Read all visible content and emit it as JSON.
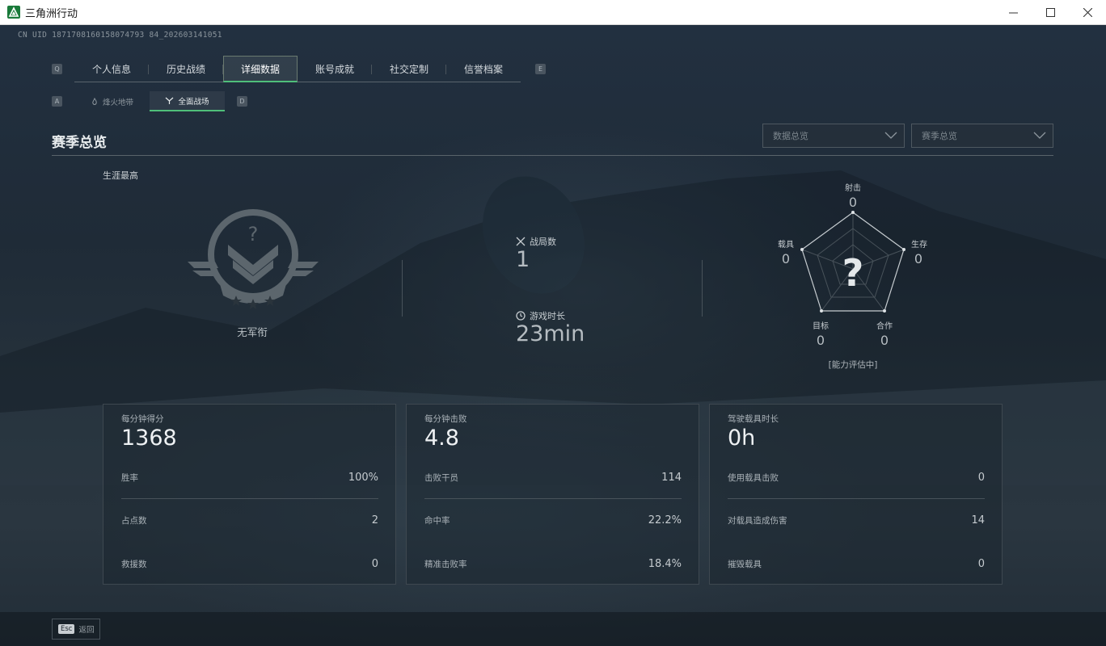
{
  "window": {
    "title": "三角洲行动",
    "minimize": "—",
    "maximize": "☐",
    "close": "✕"
  },
  "uid": "CN UID 18717081601580747938420260314105 1",
  "uid_text": "CN UID 1871708160158074793842026031410 51",
  "uid_display": "CN UID 1871708160158074793842026031410 51",
  "uid_exact": "CN UID 1871708160158074793 84_202603141051",
  "key_hints": {
    "prev_tab": "Q",
    "next_tab": "E",
    "prev_sub": "A",
    "next_sub": "D"
  },
  "main_tabs": [
    {
      "label": "个人信息",
      "active": false
    },
    {
      "label": "历史战绩",
      "active": false
    },
    {
      "label": "详细数据",
      "active": true
    },
    {
      "label": "账号成就",
      "active": false
    },
    {
      "label": "社交定制",
      "active": false
    },
    {
      "label": "信誉档案",
      "active": false
    }
  ],
  "sub_tabs": [
    {
      "label": "烽火地带",
      "icon": "fire-icon",
      "active": false
    },
    {
      "label": "全面战场",
      "icon": "battlefield-icon",
      "active": true
    }
  ],
  "section": {
    "title": "赛季总览"
  },
  "dropdowns": {
    "data": "数据总览",
    "season": "赛季总览"
  },
  "career": {
    "label": "生涯最高",
    "rank_name": "无军衔"
  },
  "summary": {
    "matches_label": "战局数",
    "matches_value": "1",
    "time_label": "游戏时长",
    "time_value": "23min"
  },
  "radar": {
    "shoot_label": "射击",
    "shoot_value": "0",
    "survive_label": "生存",
    "survive_value": "0",
    "coop_label": "合作",
    "coop_value": "0",
    "target_label": "目标",
    "target_value": "0",
    "vehicle_label": "载具",
    "vehicle_value": "0",
    "caption": "[能力评估中]",
    "scores": {
      "shoot": 0,
      "survive": 0,
      "coop": 0,
      "target": 0,
      "vehicle": 0
    }
  },
  "cards": [
    {
      "head": "每分钟得分",
      "big": "1368",
      "rows": [
        {
          "k": "胜率",
          "v": "100%"
        },
        {
          "k": "占点数",
          "v": "2"
        },
        {
          "k": "救援数",
          "v": "0"
        }
      ]
    },
    {
      "head": "每分钟击败",
      "big": "4.8",
      "rows": [
        {
          "k": "击败干员",
          "v": "114"
        },
        {
          "k": "命中率",
          "v": "22.2%"
        },
        {
          "k": "精准击败率",
          "v": "18.4%"
        }
      ]
    },
    {
      "head": "驾驶载具时长",
      "big": "0h",
      "rows": [
        {
          "k": "使用载具击败",
          "v": "0"
        },
        {
          "k": "对载具造成伤害",
          "v": "14"
        },
        {
          "k": "摧毁载具",
          "v": "0"
        }
      ]
    }
  ],
  "footer": {
    "esc_key": "Esc",
    "esc_label": "返回"
  },
  "colors": {
    "accent": "#4fbf7a",
    "background": "#1f2b37"
  }
}
